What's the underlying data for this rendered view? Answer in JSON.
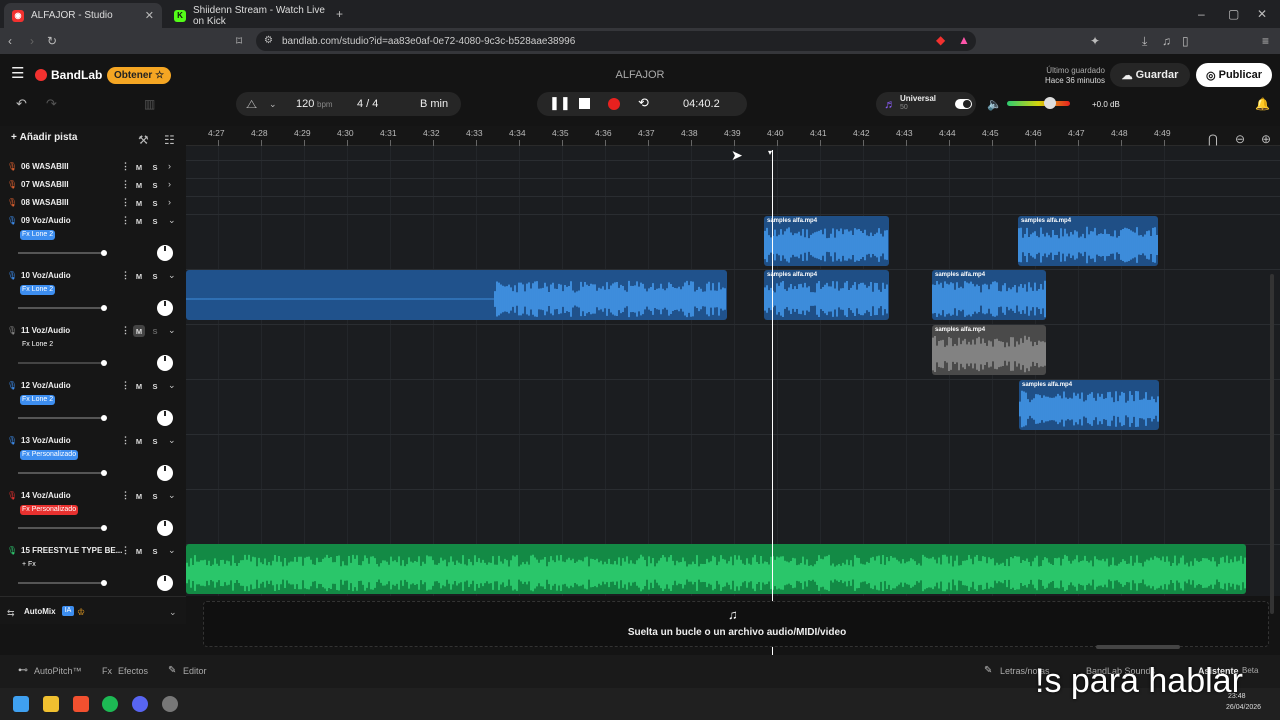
{
  "browser": {
    "tabs": [
      {
        "label": "ALFAJOR - Studio"
      },
      {
        "label": "Shiidenn Stream - Watch Live on Kick"
      }
    ],
    "new_tab": "+",
    "url": "bandlab.com/studio?id=aa83e0af-0e72-4080-9c3c-b528aae38996"
  },
  "header": {
    "brand": "BandLab",
    "obtener": "Obtener",
    "project_title": "ALFAJOR",
    "save_status_1": "Último guardado",
    "save_status_2": "Hace 36 minutos",
    "save_label": "Guardar",
    "publish_label": "Publicar"
  },
  "toolbar": {
    "bpm": "120",
    "bpm_unit": "bpm",
    "time_signature": "4 / 4",
    "key": "B min",
    "time": "04:40.2",
    "instrument": "Universal",
    "instrument_sub": "50",
    "volume_db": "+0.0 dB"
  },
  "tracks_panel": {
    "add_track": "Añadir pista",
    "automix": "AutoMix",
    "automix_badge": "IA"
  },
  "ruler": [
    "4:27",
    "4:28",
    "4:29",
    "4:30",
    "4:31",
    "4:32",
    "4:33",
    "4:34",
    "4:35",
    "4:36",
    "4:37",
    "4:38",
    "4:39",
    "4:40",
    "4:41",
    "4:42",
    "4:43",
    "4:44",
    "4:45",
    "4:46",
    "4:47",
    "4:48",
    "4:49"
  ],
  "tracks": [
    {
      "name": "06  WASABIII",
      "color": "#e0612f",
      "fx": ""
    },
    {
      "name": "07  WASABIII",
      "color": "#e0612f",
      "fx": ""
    },
    {
      "name": "08  WASABIII",
      "color": "#e0612f",
      "fx": ""
    },
    {
      "name": "09  Voz/Audio",
      "color": "#3d8ef0",
      "fx": "Fx Lone 2"
    },
    {
      "name": "10  Voz/Audio",
      "color": "#3d8ef0",
      "fx": "Fx Lone 2"
    },
    {
      "name": "11  Voz/Audio",
      "color": "#888888",
      "fx": "Fx Lone 2"
    },
    {
      "name": "12  Voz/Audio",
      "color": "#3d8ef0",
      "fx": "Fx Lone 2"
    },
    {
      "name": "13  Voz/Audio",
      "color": "#3d8ef0",
      "fx": "Fx Personalizado"
    },
    {
      "name": "14  Voz/Audio",
      "color": "#e8312f",
      "fx": "Fx Personalizado"
    },
    {
      "name": "15  FREESTYLE TYPE BE...",
      "color": "#2ecc71",
      "fx": "+ Fx"
    }
  ],
  "clip_label": "samples alfa.mp4",
  "track_buttons": {
    "mute": "M",
    "solo": "S",
    "menu": "⋮"
  },
  "drop_zone": "Suelta un bucle o un archivo audio/MIDI/video",
  "bottom": {
    "autopitch": "AutoPitch™",
    "effects": "Efectos",
    "editor": "Editor",
    "lyrics": "Letras/notas",
    "sounds": "BandLab Sounds",
    "assistant": "Asistente",
    "assistant_badge": "Beta"
  },
  "taskbar": {
    "time": "23:48",
    "date": "26/04/2026"
  },
  "subtitle": "!s para hablar",
  "colors": {
    "accent": "#f2312f",
    "clip_blue": "#2f7fd6",
    "clip_green": "#1fae54"
  }
}
